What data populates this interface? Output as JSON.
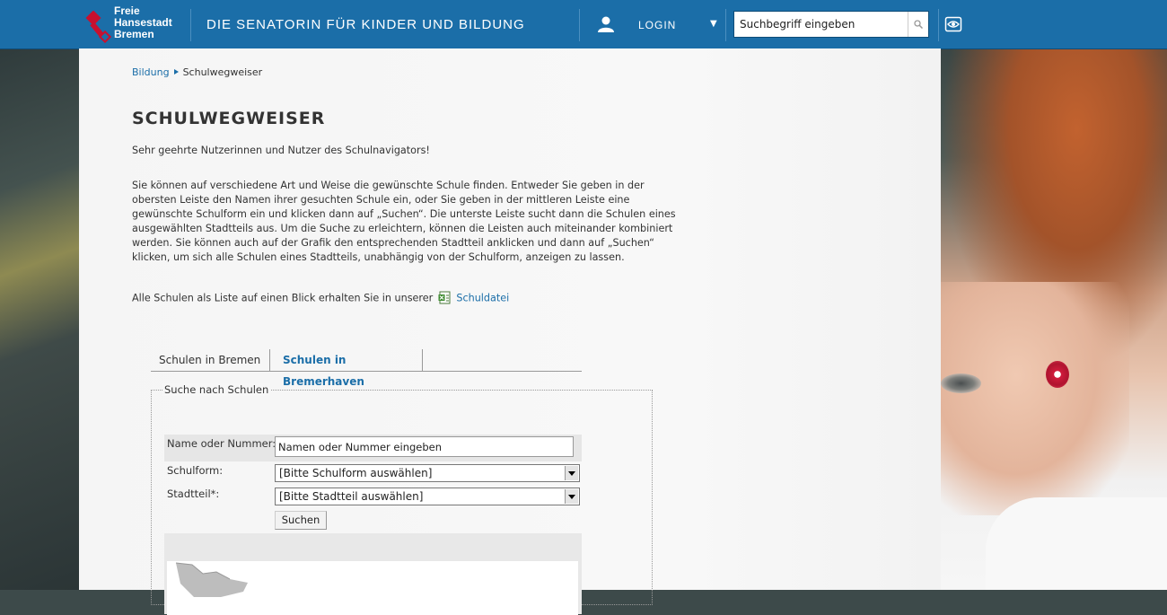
{
  "header": {
    "logo_lines": [
      "Freie",
      "Hansestadt",
      "Bremen"
    ],
    "department": "DIE SENATORIN FÜR KINDER UND BILDUNG",
    "login_label": "LOGIN",
    "search_placeholder": "Suchbegriff eingeben",
    "colors": {
      "bar": "#1b6ea8",
      "logo_key": "#c8102e"
    }
  },
  "breadcrumb": {
    "home": "Bildung",
    "current": "Schulwegweiser"
  },
  "page_title": "SCHULWEGWEISER",
  "intro": "Sehr geehrte Nutzerinnen und Nutzer des Schulnavigators!",
  "paragraph": "Sie können auf verschiedene Art und Weise die gewünschte Schule finden. Entweder Sie geben in der obersten Leiste den Namen ihrer gesuchten Schule ein, oder Sie geben in der mittleren Leiste eine gewünschte Schulform ein und klicken dann auf „Suchen“. Die unterste Leiste sucht dann die Schulen eines ausgewählten Stadtteils aus. Um die Suche zu erleichtern, können die Leisten auch miteinander kombiniert werden. Sie können auch auf der Grafik den entsprechenden Stadtteil anklicken und dann auf „Suchen“ klicken, um sich alle Schulen eines Stadtteils, unabhängig von der Schulform, anzeigen zu lassen.",
  "list_text": "Alle Schulen als Liste auf einen Blick erhalten Sie in unserer",
  "list_link": "Schuldatei",
  "tabs": [
    {
      "label": "Schulen in Bremen"
    },
    {
      "label": "Schulen in Bremerhaven"
    }
  ],
  "form": {
    "legend": "Suche nach Schulen",
    "name_label": "Name oder Nummer:",
    "name_placeholder": "Namen oder Nummer eingeben",
    "schulform_label": "Schulform:",
    "schulform_value": "[Bitte Schulform auswählen]",
    "stadtteil_label": "Stadtteil*:",
    "stadtteil_value": "[Bitte Stadtteil auswählen]",
    "submit_label": "Suchen"
  }
}
